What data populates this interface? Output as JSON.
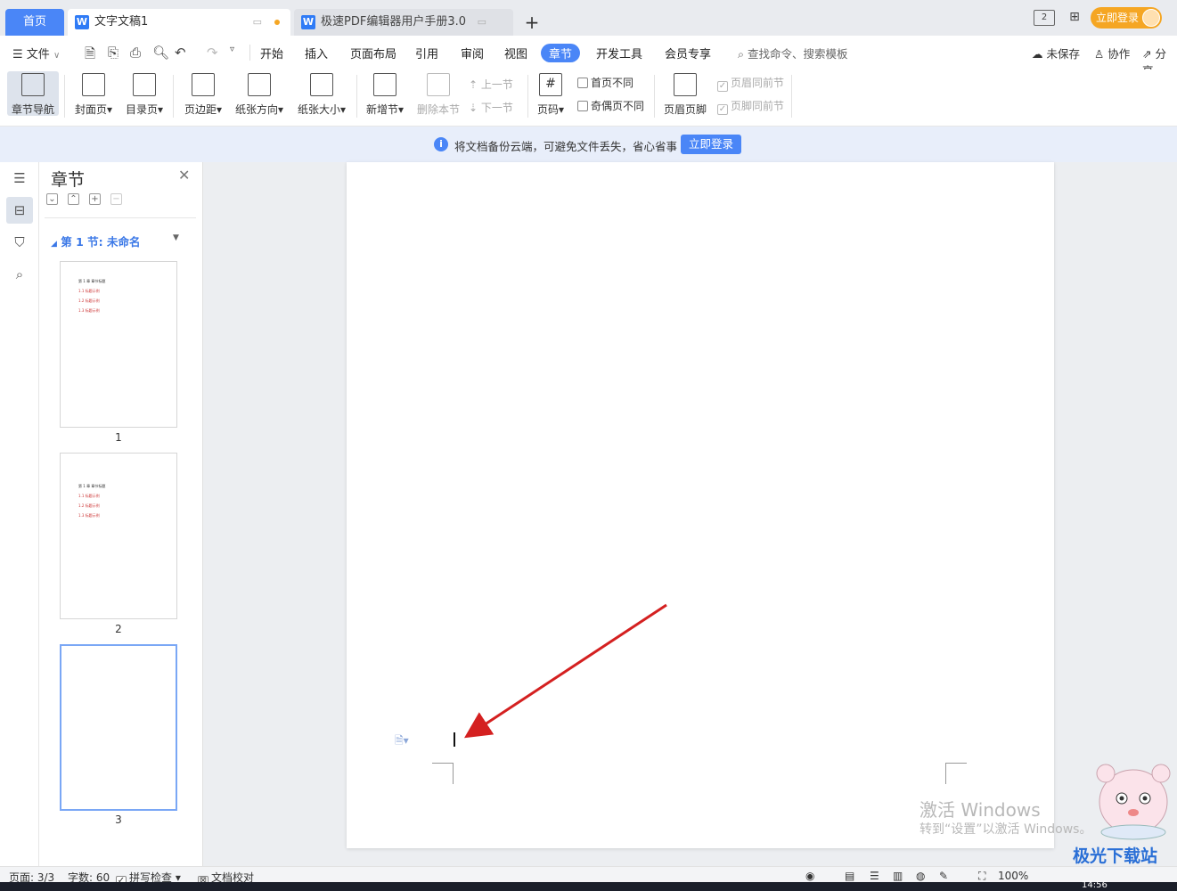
{
  "tabs": {
    "home": "首页",
    "active_doc": "文字文稿1",
    "inactive_doc": "极速PDF编辑器用户手册3.0",
    "window_badge": "2",
    "login": "立即登录"
  },
  "menu": {
    "file": "文件",
    "tabs": [
      "开始",
      "插入",
      "页面布局",
      "引用",
      "审阅",
      "视图",
      "章节",
      "开发工具",
      "会员专享"
    ],
    "active_tab": "章节",
    "search_placeholder": "查找命令、搜索模板",
    "unsaved": "未保存",
    "collab": "协作",
    "share": "分享"
  },
  "ribbon": {
    "chapter_nav": "章节导航",
    "cover": "封面页",
    "toc": "目录页",
    "margins": "页边距",
    "orientation": "纸张方向",
    "size": "纸张大小",
    "new_section": "新增节",
    "delete_section": "删除本节",
    "prev_section": "上一节",
    "next_section": "下一节",
    "page_number": "页码",
    "first_page_diff": "首页不同",
    "odd_even_diff": "奇偶页不同",
    "header_footer": "页眉页脚",
    "header_same_prev": "页眉同前节",
    "footer_same_prev": "页脚同前节"
  },
  "notice": {
    "text": "将文档备份云端，可避免文件丢失，省心省事",
    "button": "立即登录"
  },
  "panel": {
    "title": "章节",
    "section": "第 1 节: 未命名",
    "thumb_lines": [
      "第 1 章 章节标题",
      "1.1 标题示例",
      "1.2 标题示例",
      "1.3 标题示例"
    ],
    "pages": [
      "1",
      "2",
      "3"
    ],
    "selected_page": "3"
  },
  "canvas": {
    "watermark_title": "激活 Windows",
    "watermark_sub": "转到“设置”以激活 Windows。",
    "site_logo": "极光下载站"
  },
  "status": {
    "page": "页面: 3/3",
    "words": "字数: 60",
    "spell": "拼写检查",
    "proof": "文档校对",
    "zoom": "100%",
    "clock": "14:56"
  },
  "colors": {
    "accent": "#4a86f7",
    "arrow": "#d42020",
    "section_label": "#3b78e7"
  }
}
